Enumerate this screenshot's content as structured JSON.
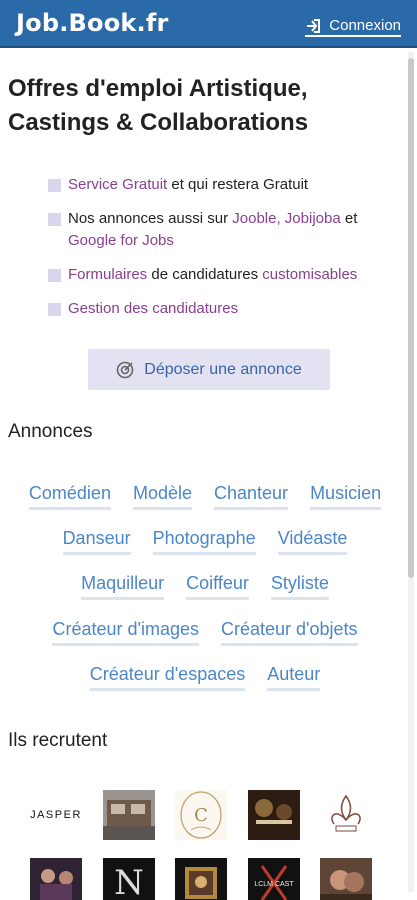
{
  "header": {
    "brand": "Job.Book.fr",
    "login_label": "Connexion",
    "bg_color": "#2b6aa8"
  },
  "page": {
    "title": "Offres d'emploi Artistique, Castings & Collaborations"
  },
  "features": [
    {
      "parts": [
        {
          "text": "Service Gratuit",
          "hl": true
        },
        {
          "text": " et qui restera Gratuit",
          "hl": false
        }
      ]
    },
    {
      "parts": [
        {
          "text": "Nos annonces aussi sur ",
          "hl": false
        },
        {
          "text": "Jooble, Jobijoba",
          "hl": true
        },
        {
          "text": " et ",
          "hl": false
        },
        {
          "text": "Google for Jobs",
          "hl": true
        }
      ]
    },
    {
      "parts": [
        {
          "text": "Formulaires",
          "hl": true
        },
        {
          "text": " de candidatures ",
          "hl": false
        },
        {
          "text": "customisables",
          "hl": true
        }
      ]
    },
    {
      "parts": [
        {
          "text": "Gestion des candidatures",
          "hl": true
        }
      ]
    }
  ],
  "cta": {
    "label": "Déposer une annonce",
    "icon": "target-icon"
  },
  "annonces": {
    "title": "Annonces",
    "rows": [
      [
        "Comédien",
        "Modèle",
        "Chanteur",
        "Musicien"
      ],
      [
        "Danseur",
        "Photographe",
        "Vidéaste"
      ],
      [
        "Maquilleur",
        "Coiffeur",
        "Styliste"
      ],
      [
        "Créateur d'images",
        "Créateur d'objets"
      ],
      [
        "Créateur d'espaces",
        "Auteur"
      ]
    ]
  },
  "recruiters": {
    "title": "Ils recrutent",
    "row1": [
      {
        "name": "jasper-logo",
        "text": "JASPER"
      },
      {
        "name": "street-photo-logo",
        "text": ""
      },
      {
        "name": "c-monogram-logo",
        "text": "C"
      },
      {
        "name": "dark-poster-logo",
        "text": ""
      },
      {
        "name": "fleur-de-lis-logo",
        "text": ""
      }
    ],
    "row2": [
      {
        "name": "stage-photo-logo",
        "text": ""
      },
      {
        "name": "n-letter-logo",
        "text": "N"
      },
      {
        "name": "framed-painting-logo",
        "text": ""
      },
      {
        "name": "casting-logo",
        "text": "LCLM CAST"
      },
      {
        "name": "portrait-photo-logo",
        "text": ""
      }
    ]
  },
  "colors": {
    "accent_text": "#8a3f8f",
    "link": "#4b86c8",
    "cta_bg": "#e2e2f3"
  }
}
